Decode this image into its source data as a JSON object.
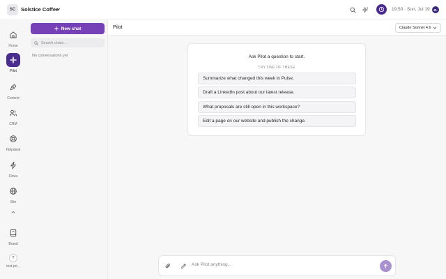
{
  "workspace": {
    "initials": "SC",
    "name": "Solstice Coffee"
  },
  "topbar": {
    "datetime": "19:50 · Sun, Jul 19",
    "user_initials": "ZL"
  },
  "rail": {
    "items": [
      {
        "label": "Home",
        "icon": "home-icon"
      },
      {
        "label": "Pilot",
        "icon": "pilot-icon",
        "active": true
      },
      {
        "label": "Content",
        "icon": "pen-nib-icon"
      },
      {
        "label": "CRM",
        "icon": "users-icon"
      },
      {
        "label": "Helpdesk",
        "icon": "lifebuoy-icon"
      },
      {
        "label": "Flows",
        "icon": "lightning-icon"
      },
      {
        "label": "Site",
        "icon": "globe-icon"
      },
      {
        "label": "Brand",
        "icon": "book-icon"
      },
      {
        "label": "test-pri...",
        "icon": "avatar",
        "initial": "T"
      }
    ]
  },
  "conversations": {
    "new_chat_label": "New chat",
    "search_placeholder": "Search chats...",
    "empty_text": "No conversations yet"
  },
  "main": {
    "title": "Pilot",
    "model": "Claude Sonnet 4.6",
    "card": {
      "title": "Ask Pilot a question to start.",
      "subtitle": "TRY ONE OF THESE",
      "suggestions": [
        "Summarize what changed this week in Pulse.",
        "Draft a LinkedIn post about our latest release.",
        "What proposals are still open in this workspace?",
        "Edit a page on our website and publish the change."
      ]
    },
    "composer": {
      "placeholder": "Ask Pilot anything..."
    }
  },
  "colors": {
    "accent": "#7641b6",
    "pilot_active": "#4a2c8f",
    "send_button": "#a991cf"
  }
}
